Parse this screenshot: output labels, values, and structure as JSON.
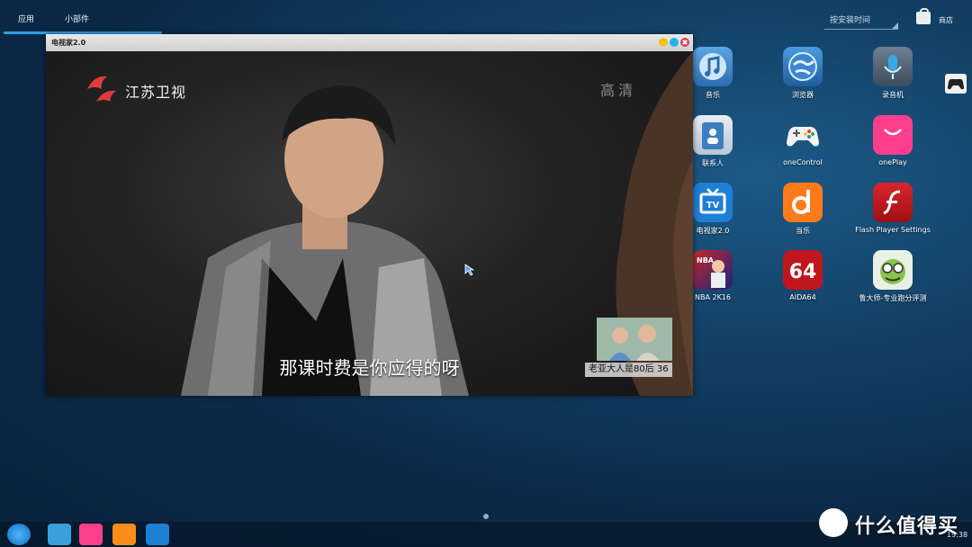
{
  "header": {
    "tabs": [
      {
        "label": "应用",
        "active": true
      },
      {
        "label": "小部件",
        "active": false
      }
    ],
    "sort_select": {
      "value": "按安装时间"
    },
    "store": {
      "label": "商店"
    }
  },
  "player_window": {
    "title": "电视家2.0",
    "channel_name": "江苏卫视",
    "hd_tag": "高清",
    "subtitle": "那课时费是你应得的呀",
    "program_tag": "老亚大人是80后 36"
  },
  "apps": [
    {
      "label": "音乐",
      "icon": "music-icon",
      "color": "#3f7fc4"
    },
    {
      "label": "浏览器",
      "icon": "browser-icon",
      "color": "#2b6fb4"
    },
    {
      "label": "录音机",
      "icon": "microphone-icon",
      "color": "#4d5e70"
    },
    {
      "label": "联系人",
      "icon": "contacts-icon",
      "color": "#4a8cc8"
    },
    {
      "label": "oneControl",
      "icon": "gamepad-icon",
      "color": "#ffffff"
    },
    {
      "label": "onePlay",
      "icon": "shopping-bag-icon",
      "color": "#ff3f8e"
    },
    {
      "label": "电视家2.0",
      "icon": "tv-icon",
      "color": "#1e7fd6"
    },
    {
      "label": "当乐",
      "icon": "dangle-icon",
      "color": "#ff7a1a"
    },
    {
      "label": "Flash Player Settings",
      "icon": "flash-icon",
      "color": "#c0171c"
    },
    {
      "label": "NBA 2K16",
      "icon": "nba-icon",
      "color": "#c62828"
    },
    {
      "label": "AIDA64",
      "icon": "aida64-icon",
      "color": "#c0171c"
    },
    {
      "label": "鲁大师-专业跑分评测",
      "icon": "ludashi-icon",
      "color": "#e9f0e6"
    }
  ],
  "taskbar": {
    "items": [
      {
        "icon": "launcher-icon",
        "color": "#1c8fe0"
      },
      {
        "icon": "file-manager-icon",
        "color": "#3aa0dc"
      },
      {
        "icon": "oneplay-icon",
        "color": "#ff3f8e"
      },
      {
        "icon": "uc-browser-icon",
        "color": "#ff8c1a"
      },
      {
        "icon": "tv-icon",
        "color": "#1e7fd6"
      }
    ],
    "clock": "19:38"
  },
  "watermark": {
    "text": "什么值得买"
  }
}
